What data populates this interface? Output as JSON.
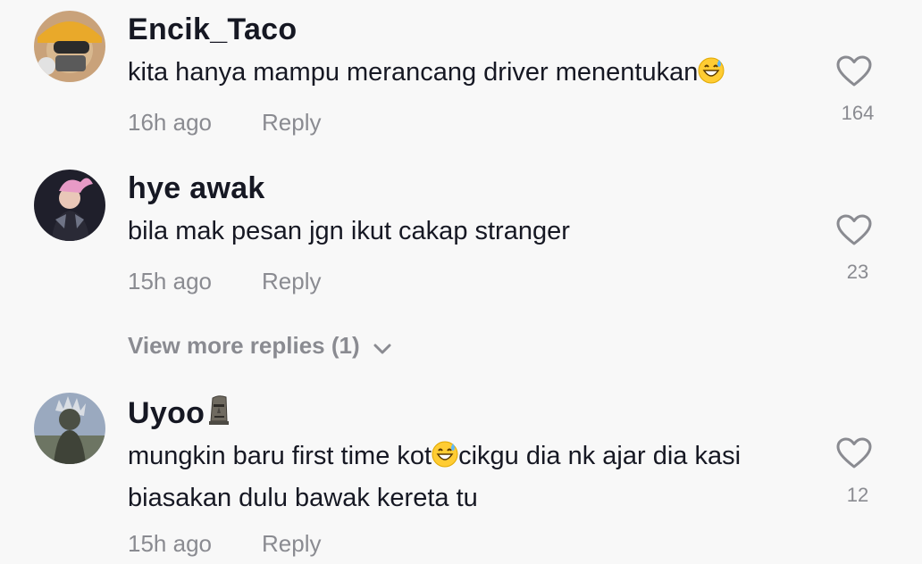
{
  "comments": [
    {
      "username": "Encik_Taco",
      "username_emoji": "",
      "text_before": "kita hanya mampu merancang driver menentukan",
      "text_after": "",
      "text_line2": "",
      "emoji": "grinning-sweat-emoji",
      "time": "16h ago",
      "reply_label": "Reply",
      "likes": "164"
    },
    {
      "username": "hye awak",
      "text_before": "bila mak pesan jgn ikut cakap stranger",
      "text_after": "",
      "text_line2": "",
      "time": "15h ago",
      "reply_label": "Reply",
      "likes": "23"
    },
    {
      "username": "Uyoo",
      "username_emoji": "moai-emoji",
      "text_before": "mungkin baru first time kot",
      "text_after": "cikgu dia nk ajar dia kasi",
      "text_line2": "biasakan dulu bawak kereta tu",
      "emoji": "grinning-sweat-emoji",
      "time": "15h ago",
      "reply_label": "Reply",
      "likes": "12"
    }
  ],
  "view_more": {
    "label": "View more replies (1)"
  },
  "colors": {
    "background": "#f8f8f8",
    "primary_text": "#161823",
    "secondary_text": "#8a8b91"
  }
}
